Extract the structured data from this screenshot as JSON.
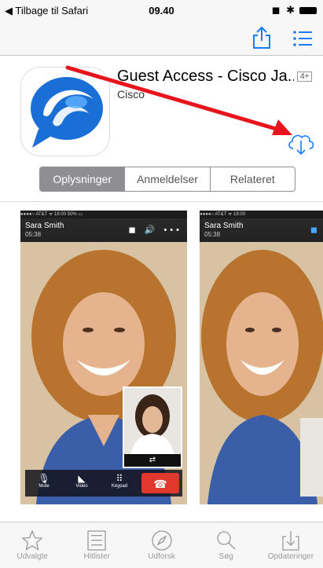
{
  "status_bar": {
    "back_label": "◀ Tilbage til Safari",
    "time": "09.40",
    "right_icons": "◼ ✱"
  },
  "app": {
    "title": "Guest Access - Cisco Ja...",
    "developer": "Cisco",
    "age_rating": "4+",
    "icon_color": "#1a6fd6"
  },
  "segment": {
    "tabs": [
      {
        "label": "Oplysninger",
        "active": true
      },
      {
        "label": "Anmeldelser",
        "active": false
      },
      {
        "label": "Relateret",
        "active": false
      }
    ]
  },
  "screenshots": [
    {
      "status": "●●●●○ AT&T ᯤ        18:00        50% ▭",
      "caller_name": "Sara Smith",
      "caller_time": "05:38",
      "call_icons": "◼ 🔊 •••",
      "controls": [
        {
          "icon": "🎙",
          "label": "Mute"
        },
        {
          "icon": "◣",
          "label": "Video"
        },
        {
          "icon": "⠿",
          "label": "Keypad"
        }
      ],
      "swap_label": "⇄"
    },
    {
      "status": "●●●●○ AT&T ᯤ        18:00",
      "caller_name": "Sara Smith",
      "caller_time": "05:38"
    }
  ],
  "tabbar": {
    "items": [
      {
        "label": "Udvalgte",
        "icon": "star-icon"
      },
      {
        "label": "Hitlister",
        "icon": "list-icon"
      },
      {
        "label": "Udforsk",
        "icon": "compass-icon"
      },
      {
        "label": "Søg",
        "icon": "search-icon"
      },
      {
        "label": "Opdateringer",
        "icon": "download-tray-icon"
      }
    ]
  },
  "colors": {
    "accent": "#1a7bff",
    "annotation_arrow": "#e8141c"
  }
}
